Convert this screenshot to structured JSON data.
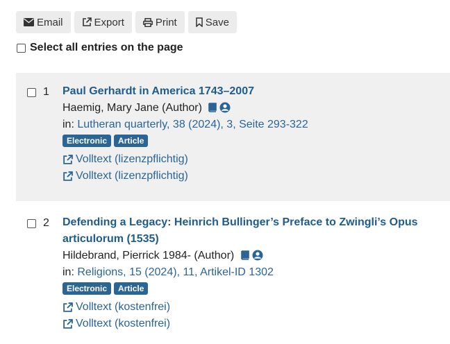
{
  "toolbar": {
    "email": "Email",
    "export": "Export",
    "print": "Print",
    "save": "Save"
  },
  "select_all": "Select all entries on the page",
  "entries": [
    {
      "number": "1",
      "title": "Paul Gerhardt in America 1743–2007",
      "author": "Haemig, Mary Jane (Author)",
      "in_label": "in:",
      "source": "Lutheran quarterly, 38 (2024), 3, Seite 293-322",
      "badges": [
        "Electronic",
        "Article"
      ],
      "links": [
        "Volltext (lizenzpflichtig)",
        "Volltext (lizenzpflichtig)"
      ]
    },
    {
      "number": "2",
      "title_line1": "Defending a Legacy: Heinrich Bullinger’s Preface to Zwingli’s Opus",
      "title_line2": "articulorum (1535)",
      "author": "Hildebrand, Pierrick 1984- (Author)",
      "in_label": "in:",
      "source": "Religions, 15 (2024), 11, Artikel-ID 1302",
      "badges": [
        "Electronic",
        "Article"
      ],
      "links": [
        "Volltext (kostenfrei)",
        "Volltext (kostenfrei)"
      ]
    }
  ],
  "colors": {
    "link": "#2a6496",
    "title": "#1f5c8a",
    "badge": "#2b6593",
    "shade": "#f0f0f0"
  }
}
